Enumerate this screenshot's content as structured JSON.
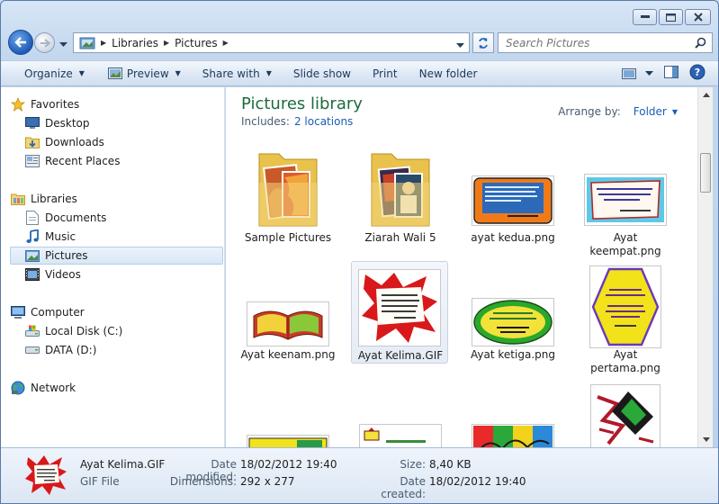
{
  "window": {
    "title": "Pictures"
  },
  "address": {
    "crumbs": [
      "Libraries",
      "Pictures"
    ]
  },
  "search": {
    "placeholder": "Search Pictures"
  },
  "toolbar": {
    "organize": "Organize",
    "preview": "Preview",
    "share_with": "Share with",
    "slide_show": "Slide show",
    "print": "Print",
    "new_folder": "New folder"
  },
  "nav": {
    "favorites": "Favorites",
    "desktop": "Desktop",
    "downloads": "Downloads",
    "recent_places": "Recent Places",
    "libraries": "Libraries",
    "documents": "Documents",
    "music": "Music",
    "pictures": "Pictures",
    "videos": "Videos",
    "computer": "Computer",
    "local_disk": "Local Disk (C:)",
    "data_disk": "DATA (D:)",
    "network": "Network"
  },
  "library": {
    "title": "Pictures library",
    "includes_label": "Includes:",
    "includes_link": "2 locations",
    "arrange_label": "Arrange by:",
    "arrange_value": "Folder"
  },
  "items": [
    {
      "name": "Sample Pictures"
    },
    {
      "name": "Ziarah Wali 5"
    },
    {
      "name": "ayat kedua.png"
    },
    {
      "name": "Ayat keempat.png"
    },
    {
      "name": "Ayat keenam.png"
    },
    {
      "name": "Ayat Kelima.GIF"
    },
    {
      "name": "Ayat ketiga.png"
    },
    {
      "name": "Ayat pertama.png"
    },
    {
      "name": ""
    },
    {
      "name": ""
    },
    {
      "name": ""
    },
    {
      "name": ""
    }
  ],
  "details": {
    "name": "Ayat Kelima.GIF",
    "type": "GIF File",
    "date_modified_label": "Date modified:",
    "date_modified": "18/02/2012 19:40",
    "dimensions_label": "Dimensions:",
    "dimensions": "292 x 277",
    "size_label": "Size:",
    "size": "8,40 KB",
    "date_created_label": "Date created:",
    "date_created": "18/02/2012 19:40"
  }
}
